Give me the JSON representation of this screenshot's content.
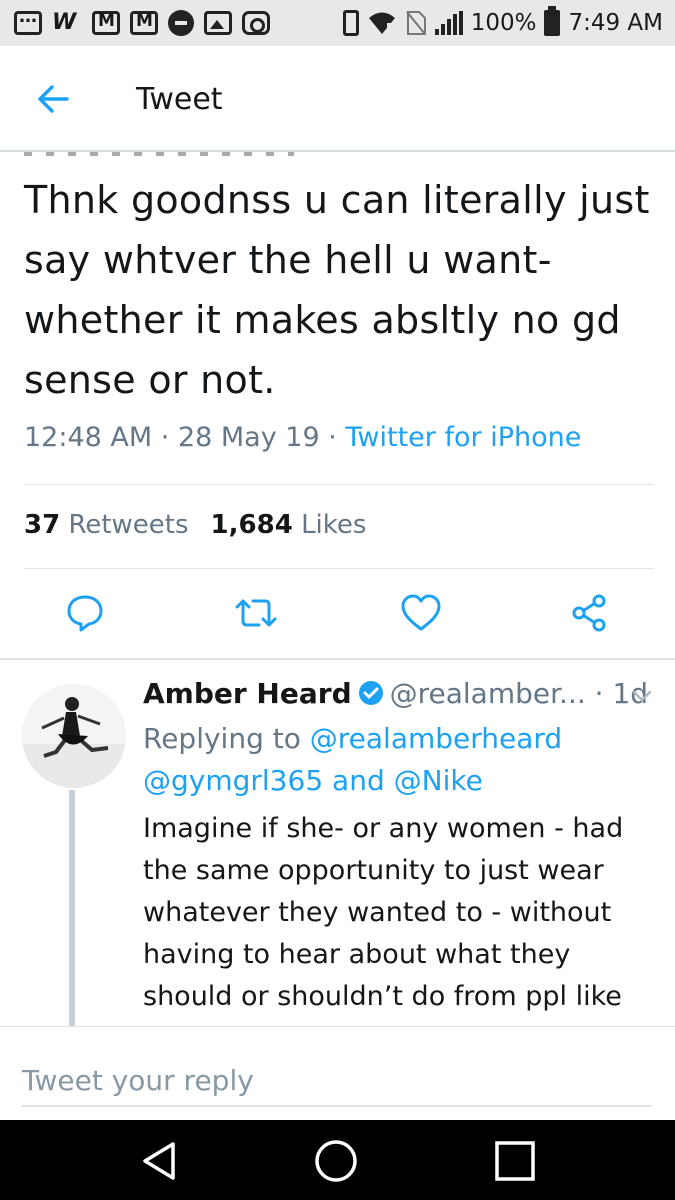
{
  "status_bar": {
    "battery": "100%",
    "time": "7:49 AM",
    "left_icons": [
      "more-icon",
      "w-icon",
      "mail-icon",
      "gmail-icon",
      "do-not-disturb-icon",
      "image-icon",
      "instagram-icon"
    ],
    "right_icons": [
      "vibrate-icon",
      "wifi-icon",
      "no-sim-icon",
      "signal-icon",
      "battery-icon"
    ]
  },
  "header": {
    "title": "Tweet",
    "back_icon": "arrow-left-icon"
  },
  "tweet": {
    "text": "Thnk goodnss u can literally just say whtver the hell u want- whether it makes absltly no gd sense or not.",
    "time": "12:48 AM",
    "date": "28 May 19",
    "source": "Twitter for iPhone",
    "retweets_count": "37",
    "retweets_label": "Retweets",
    "likes_count": "1,684",
    "likes_label": "Likes"
  },
  "actions": [
    "reply-icon",
    "retweet-icon",
    "like-icon",
    "share-icon"
  ],
  "reply": {
    "name": "Amber Heard",
    "handle": "@realamber...",
    "age": "1d",
    "replying_label": "Replying to",
    "mention_1": "@realamberheard",
    "mention_2": "@gymgrl365",
    "and_label": "and",
    "mention_3": "@Nike",
    "text": "Imagine if she- or any women - had the same opportunity to just wear whatever they wanted to - without having to hear about what they should or shouldn’t do from ppl like you. Maybe you should focus on"
  },
  "compose": {
    "placeholder": "Tweet your reply"
  },
  "navbar": [
    "back-icon",
    "home-icon",
    "recents-icon"
  ],
  "colors": {
    "accent": "#1da1f2",
    "secondary_text": "#657786",
    "primary_text": "#14171a",
    "status_bar_bg": "#e8e8e8",
    "nav_bg": "#000000"
  }
}
